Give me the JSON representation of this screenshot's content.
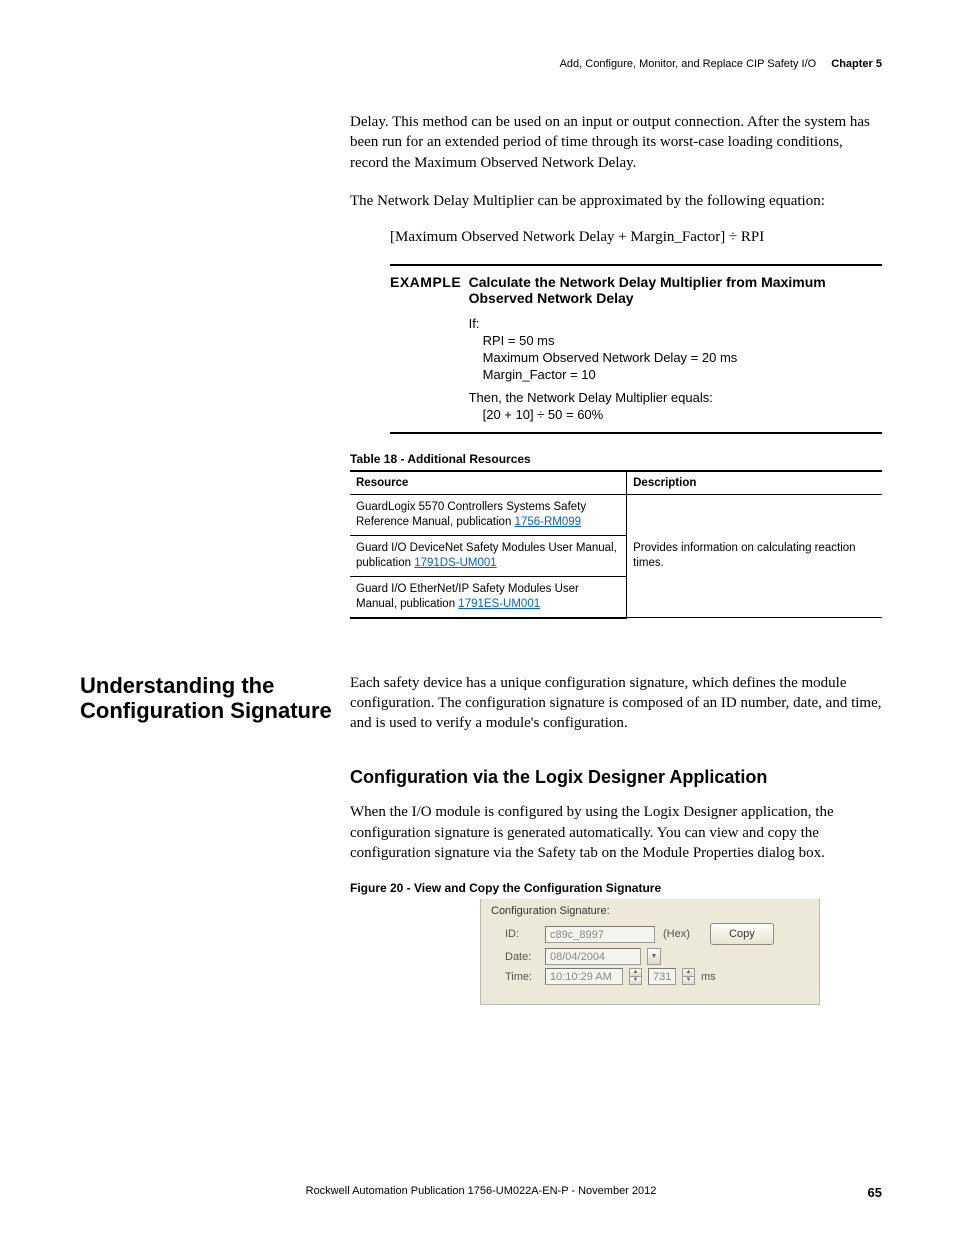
{
  "header": {
    "title": "Add, Configure, Monitor, and Replace CIP Safety I/O",
    "chapter": "Chapter 5"
  },
  "paragraphs": {
    "p1": "Delay. This method can be used on an input or output connection. After the system has been run for an extended period of time through its worst-case loading conditions, record the Maximum Observed Network Delay.",
    "p2": "The Network Delay Multiplier can be approximated by the following equation:",
    "eqn": "[Maximum Observed Network Delay + Margin_Factor] ÷ RPI"
  },
  "example": {
    "label": "EXAMPLE",
    "title": "Calculate the Network Delay Multiplier from Maximum Observed Network Delay",
    "if": "If:",
    "l1": "RPI = 50 ms",
    "l2": "Maximum Observed Network Delay = 20 ms",
    "l3": "Margin_Factor = 10",
    "then": "Then, the Network Delay Multiplier equals:",
    "result": "[20 + 10] ÷ 50 = 60%"
  },
  "table18": {
    "caption": "Table 18 - Additional Resources",
    "headers": {
      "resource": "Resource",
      "description": "Description"
    },
    "rows": [
      {
        "text": "GuardLogix 5570 Controllers Systems Safety Reference Manual, publication ",
        "link": "1756-RM099"
      },
      {
        "text": "Guard I/O DeviceNet Safety Modules User Manual, publication ",
        "link": "1791DS-UM001"
      },
      {
        "text": "Guard I/O EtherNet/IP Safety Modules User Manual, publication ",
        "link": "1791ES-UM001"
      }
    ],
    "description": "Provides information on calculating reaction times."
  },
  "section": {
    "sideHeading": "Understanding the Configuration Signature",
    "intro": "Each safety device has a unique configuration signature, which defines the module configuration. The configuration signature is composed of an ID number, date, and time, and is used to verify a module's configuration.",
    "h2": "Configuration via the Logix Designer Application",
    "p": "When the I/O module is configured by using the Logix Designer application, the configuration signature is generated automatically. You can view and copy the configuration signature via the Safety tab on the Module Properties dialog box.",
    "figCaption": "Figure 20 - View and Copy the Configuration Signature"
  },
  "figure": {
    "groupLabel": "Configuration Signature:",
    "idLabel": "ID:",
    "idValue": "c89c_8997",
    "hex": "(Hex)",
    "copy": "Copy",
    "dateLabel": "Date:",
    "dateValue": "08/04/2004",
    "timeLabel": "Time:",
    "timeValue": "10:10:29 AM",
    "ms": "731",
    "msUnit": "ms"
  },
  "footer": {
    "pub": "Rockwell Automation Publication 1756-UM022A-EN-P - November 2012",
    "page": "65"
  }
}
